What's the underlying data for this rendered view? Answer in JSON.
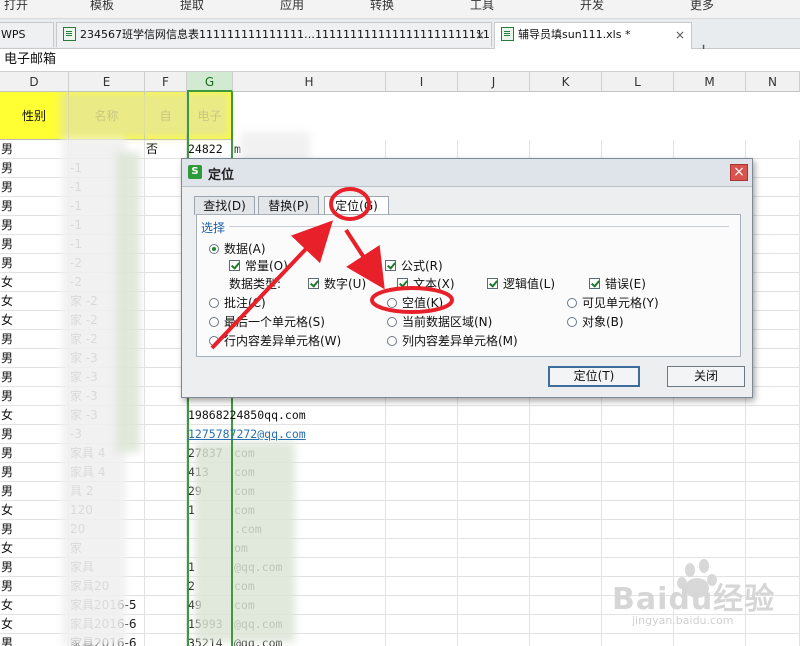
{
  "menu_strip": [
    "打开",
    "模板",
    "提取",
    "应用",
    "转换",
    "工具",
    "开发",
    "更多"
  ],
  "tabs": [
    {
      "label": "WPS",
      "active": false
    },
    {
      "label": "234567班学信网信息表111111111111111…1111111111111111111111111.xls",
      "active": false
    },
    {
      "label": "辅导员填sun111.xls *",
      "active": true
    }
  ],
  "tab_close_symbol": "×",
  "new_tab_symbol": "+",
  "name_box": "电子邮箱",
  "columns": [
    "D",
    "E",
    "F",
    "G",
    "H",
    "I",
    "J",
    "K",
    "L",
    "M",
    "N"
  ],
  "header_row": {
    "D": "性别",
    "E": "名称",
    "F": "自",
    "G": "电子"
  },
  "rows": [
    {
      "D": "男",
      "E": "",
      "F": "否",
      "G": "24822",
      "H": "m"
    },
    {
      "D": "男",
      "E": "-1"
    },
    {
      "D": "男",
      "E": "-1"
    },
    {
      "D": "男",
      "E": "-1"
    },
    {
      "D": "男",
      "E": "-1"
    },
    {
      "D": "男",
      "E": "-1"
    },
    {
      "D": "男",
      "E": "-2"
    },
    {
      "D": "女",
      "E": "-2"
    },
    {
      "D": "女",
      "E": "家 -2"
    },
    {
      "D": "女",
      "E": "家 -2"
    },
    {
      "D": "男",
      "E": "家 -2"
    },
    {
      "D": "男",
      "E": "家 -3"
    },
    {
      "D": "男",
      "E": "家 -3"
    },
    {
      "D": "男",
      "E": "家 -3"
    },
    {
      "D": "女",
      "E": "家 -3",
      "G": "19868224850qq.com"
    },
    {
      "D": "男",
      "E": "-3",
      "G": "1275787272@qq.com"
    },
    {
      "D": "男",
      "E": "家具 4",
      "G": "27837",
      "H": "com"
    },
    {
      "D": "男",
      "E": "家具 4",
      "G": "413",
      "H": "com"
    },
    {
      "D": "男",
      "E": "具 2",
      "G": "29",
      "H": "com"
    },
    {
      "D": "女",
      "E": "120",
      "G": "1",
      "H": "com"
    },
    {
      "D": "男",
      "E": "20",
      "G": "",
      "H": ".com"
    },
    {
      "D": "女",
      "E": "家",
      "G": "",
      "H": "om"
    },
    {
      "D": "男",
      "E": "家具",
      "G": "1",
      "H": "@qq.com"
    },
    {
      "D": "男",
      "E": "家具20",
      "G": "2",
      "H": "com"
    },
    {
      "D": "女",
      "E": "家具2016-5",
      "G": "49",
      "H": "com"
    },
    {
      "D": "女",
      "E": "家具2016-6",
      "G": "15993",
      "H": "@qq.com"
    },
    {
      "D": "男",
      "E": "家具2016-6",
      "G": "35214",
      "H": "@qq.com"
    }
  ],
  "dialog": {
    "title": "定位",
    "app_icon": "S",
    "close": "×",
    "tabs": [
      "查找(D)",
      "替换(P)",
      "定位(G)"
    ],
    "active_tab": 2,
    "group_label": "选择",
    "options": {
      "data": "数据(A)",
      "constants": "常量(O)",
      "formulas": "公式(R)",
      "data_types": "数据类型:",
      "numbers": "数字(U)",
      "text": "文本(X)",
      "logicals": "逻辑值(L)",
      "errors": "错误(E)",
      "comments": "批注(C)",
      "blanks": "空值(K)",
      "visible_cells": "可见单元格(Y)",
      "last_cell": "最后一个单元格(S)",
      "current_region": "当前数据区域(N)",
      "objects": "对象(B)",
      "row_differences": "行内容差异单元格(W)",
      "column_differences": "列内容差异单元格(M)"
    },
    "buttons": {
      "ok": "定位(T)",
      "close": "关闭"
    }
  },
  "watermark": {
    "brand": "Baidu经验",
    "url": "jingyan.baidu.com"
  },
  "colors": {
    "header_yellow": "#ffff33",
    "selection_green": "#3c9a3c",
    "annotation_red": "#e8202a",
    "dialog_bg": "#eceef0"
  }
}
